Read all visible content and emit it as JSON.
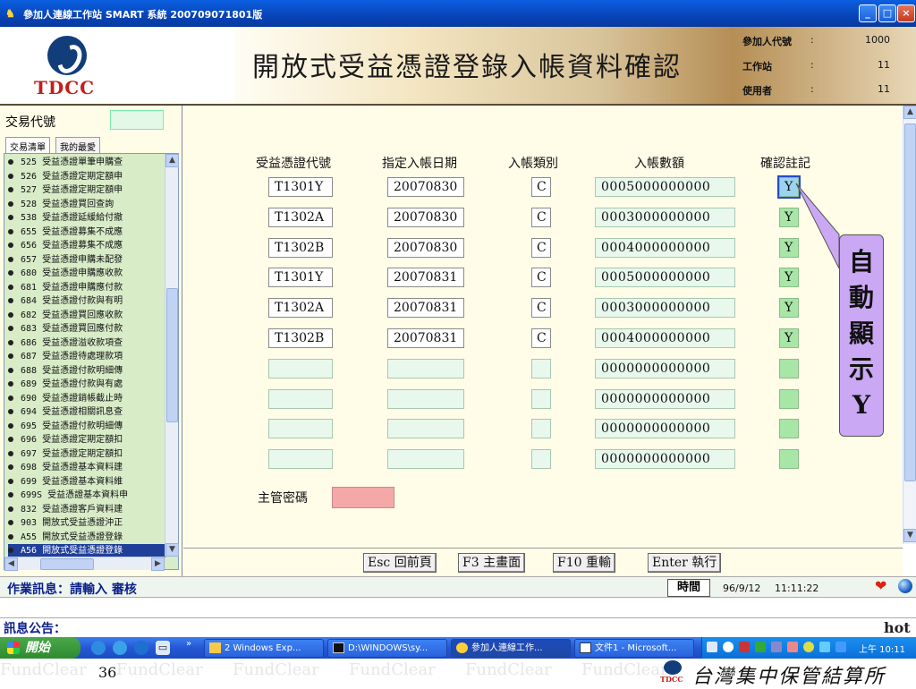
{
  "window": {
    "title": "參加人連線工作站 SMART 系統  200709071801版",
    "buttons": {
      "minimize": "_",
      "maximize": "□",
      "close": "×"
    }
  },
  "banner": {
    "logo_text": "TDCC",
    "page_title": "開放式受益憑證登錄入帳資料確認",
    "info": [
      {
        "label": "參加人代號",
        "value": "1000"
      },
      {
        "label": "工作站",
        "value": "11"
      },
      {
        "label": "使用者",
        "value": "11"
      }
    ]
  },
  "sidebar": {
    "tx_label": "交易代號",
    "tabs": [
      "交易清單",
      "我的最愛"
    ],
    "items": [
      "525 受益憑證單筆申購查",
      "526 受益憑證定期定額申",
      "527 受益憑證定期定額申",
      "528 受益憑證買回查詢",
      "538 受益憑證延緩給付撤",
      "655 受益憑證募集不成應",
      "656 受益憑證募集不成應",
      "657 受益憑證申購未配發",
      "680 受益憑證申購應收款",
      "681 受益憑證申購應付款",
      "684 受益憑證付款與有明",
      "682 受益憑證買回應收款",
      "683 受益憑證買回應付款",
      "686 受益憑證溢收款項查",
      "687 受益憑證待處理款項",
      "688 受益憑證付款明細傳",
      "689 受益憑證付款與有處",
      "690 受益憑證銷帳截止時",
      "694 受益憑證相關訊息查",
      "695 受益憑證付款明細傳",
      "696 受益憑證定期定額扣",
      "697 受益憑證定期定額扣",
      "698 受益憑證基本資料建",
      "699 受益憑證基本資料維",
      "699S 受益憑證基本資料申",
      "832 受益憑證客戶資料建",
      "903 開放式受益憑證沖正",
      "A55 開放式受益憑證登錄",
      "A56 開放式受益憑證登錄"
    ],
    "selected_index": 28
  },
  "form": {
    "columns": [
      "受益憑證代號",
      "指定入帳日期",
      "入帳類別",
      "入帳數額",
      "確認註記"
    ],
    "rows": [
      {
        "code": "T1301Y",
        "date": "20070830",
        "type": "C",
        "amount": "0005000000000",
        "confirm": "Y"
      },
      {
        "code": "T1302A",
        "date": "20070830",
        "type": "C",
        "amount": "0003000000000",
        "confirm": "Y"
      },
      {
        "code": "T1302B",
        "date": "20070830",
        "type": "C",
        "amount": "0004000000000",
        "confirm": "Y"
      },
      {
        "code": "T1301Y",
        "date": "20070831",
        "type": "C",
        "amount": "0005000000000",
        "confirm": "Y"
      },
      {
        "code": "T1302A",
        "date": "20070831",
        "type": "C",
        "amount": "0003000000000",
        "confirm": "Y"
      },
      {
        "code": "T1302B",
        "date": "20070831",
        "type": "C",
        "amount": "0004000000000",
        "confirm": "Y"
      },
      {
        "code": "",
        "date": "",
        "type": "",
        "amount": "0000000000000",
        "confirm": ""
      },
      {
        "code": "",
        "date": "",
        "type": "",
        "amount": "0000000000000",
        "confirm": ""
      },
      {
        "code": "",
        "date": "",
        "type": "",
        "amount": "0000000000000",
        "confirm": ""
      },
      {
        "code": "",
        "date": "",
        "type": "",
        "amount": "0000000000000",
        "confirm": ""
      }
    ],
    "password_label": "主管密碼",
    "callout_chars": [
      "自",
      "動",
      "顯",
      "示",
      "Y"
    ]
  },
  "function_keys": [
    "Esc 回前頁",
    "F3 主畫面",
    "F10 重輸",
    "Enter 執行"
  ],
  "status": {
    "message": "作業訊息：請輸入 審核",
    "time_label": "時間",
    "date": "96/9/12",
    "time": "11:11:22"
  },
  "notice": {
    "label": "訊息公告：",
    "hot": "hot"
  },
  "taskbar": {
    "start_label": "開始",
    "items": [
      "2 Windows Exp...",
      "D:\\WINDOWS\\sy...",
      "參加人連線工作...",
      "文件1 - Microsoft..."
    ],
    "clock": "上午 10:11"
  },
  "slide": {
    "watermark": "FundClear",
    "page_number": "36",
    "footer_logo": "TDCC",
    "footer_company": "台灣集中保管結算所"
  }
}
